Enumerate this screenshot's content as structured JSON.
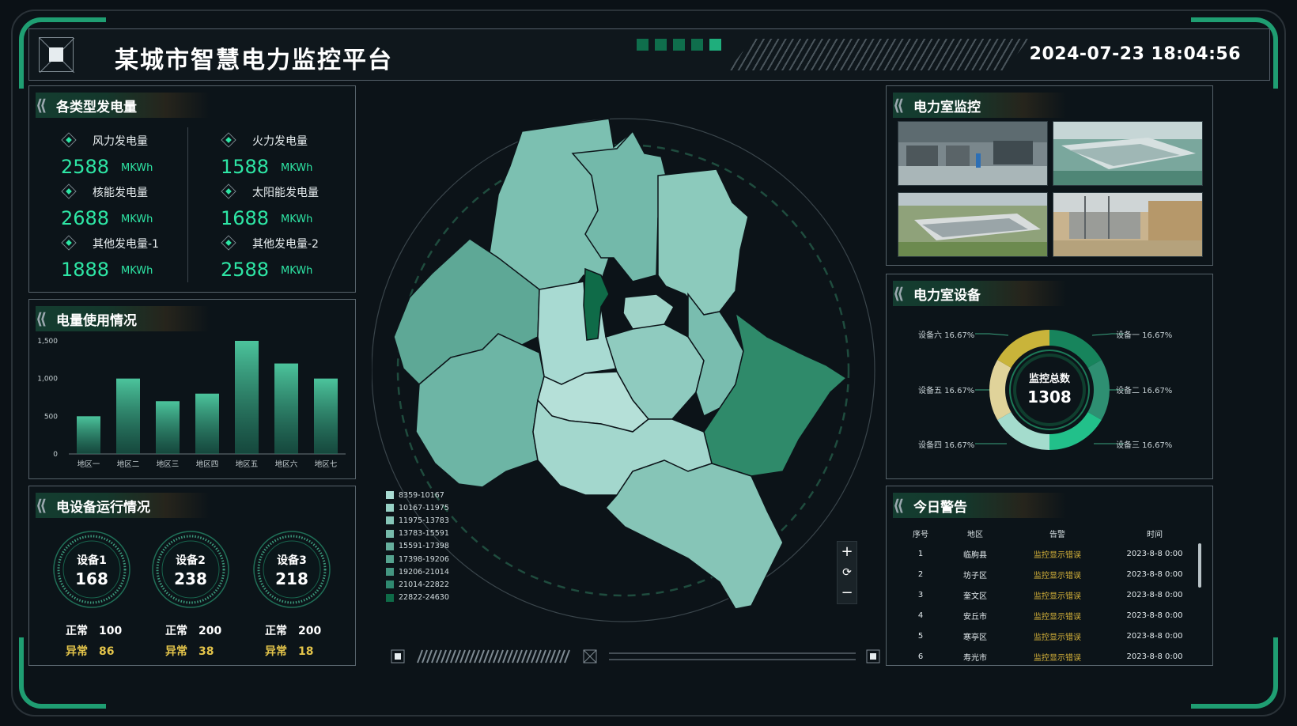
{
  "header": {
    "title": "某城市智慧电力监控平台",
    "datetime": "2024-07-23 18:04:56"
  },
  "generation": {
    "title": "各类型发电量",
    "items": [
      {
        "label": "风力发电量",
        "value": "2588",
        "unit": "MKWh"
      },
      {
        "label": "火力发电量",
        "value": "1588",
        "unit": "MKWh"
      },
      {
        "label": "核能发电量",
        "value": "2688",
        "unit": "MKWh"
      },
      {
        "label": "太阳能发电量",
        "value": "1688",
        "unit": "MKWh"
      },
      {
        "label": "其他发电量-1",
        "value": "1888",
        "unit": "MKWh"
      },
      {
        "label": "其他发电量-2",
        "value": "2588",
        "unit": "MKWh"
      }
    ]
  },
  "usage": {
    "title": "电量使用情况",
    "chart_data": {
      "type": "bar",
      "categories": [
        "地区一",
        "地区二",
        "地区三",
        "地区四",
        "地区五",
        "地区六",
        "地区七"
      ],
      "values": [
        500,
        1000,
        700,
        800,
        1500,
        1200,
        1000
      ],
      "yticks": [
        "0",
        "500",
        "1,000",
        "1,500"
      ],
      "ylim": [
        0,
        1500
      ],
      "grid": false
    }
  },
  "devices": {
    "title": "电设备运行情况",
    "items": [
      {
        "name": "设备1",
        "total": "168",
        "normal_label": "正常",
        "normal": "100",
        "abnormal_label": "异常",
        "abnormal": "86"
      },
      {
        "name": "设备2",
        "total": "238",
        "normal_label": "正常",
        "normal": "200",
        "abnormal_label": "异常",
        "abnormal": "38"
      },
      {
        "name": "设备3",
        "total": "218",
        "normal_label": "正常",
        "normal": "200",
        "abnormal_label": "异常",
        "abnormal": "18"
      }
    ]
  },
  "map": {
    "legend": [
      "8359-10167",
      "10167-11975",
      "11975-13783",
      "13783-15591",
      "15591-17398",
      "17398-19206",
      "19206-21014",
      "21014-22822",
      "22822-24630"
    ],
    "legend_colors": [
      "#a9dcd3",
      "#97d1c5",
      "#86c6b8",
      "#76bbab",
      "#66af9d",
      "#55a38f",
      "#449681",
      "#2f8970",
      "#0f6b48"
    ],
    "controls": {
      "zoom_in": "+",
      "reset": "⟳",
      "zoom_out": "−"
    }
  },
  "monitor": {
    "title": "电力室监控"
  },
  "equipment": {
    "title": "电力室设备",
    "center_label": "监控总数",
    "center_value": "1308",
    "chart_data": {
      "type": "pie",
      "categories": [
        "设备一",
        "设备二",
        "设备三",
        "设备四",
        "设备五",
        "设备六"
      ],
      "values": [
        16.67,
        16.67,
        16.67,
        16.67,
        16.67,
        16.67
      ],
      "colors": [
        "#17845c",
        "#2e8f72",
        "#22c08a",
        "#a4dccd",
        "#e0d39a",
        "#c9b43a"
      ]
    },
    "labels": [
      "设备一 16.67%",
      "设备二 16.67%",
      "设备三 16.67%",
      "设备四 16.67%",
      "设备五 16.67%",
      "设备六 16.67%"
    ]
  },
  "alerts": {
    "title": "今日警告",
    "columns": [
      "序号",
      "地区",
      "告警",
      "时间"
    ],
    "rows": [
      [
        "1",
        "临朐县",
        "监控显示错误",
        "2023-8-8 0:00"
      ],
      [
        "2",
        "坊子区",
        "监控显示错误",
        "2023-8-8 0:00"
      ],
      [
        "3",
        "奎文区",
        "监控显示错误",
        "2023-8-8 0:00"
      ],
      [
        "4",
        "安丘市",
        "监控显示错误",
        "2023-8-8 0:00"
      ],
      [
        "5",
        "寒亭区",
        "监控显示错误",
        "2023-8-8 0:00"
      ],
      [
        "6",
        "寿光市",
        "监控显示错误",
        "2023-8-8 0:00"
      ]
    ]
  },
  "colors": {
    "accent": "#2ee6a5",
    "warning": "#e2c34a",
    "brand": "#1f9e72"
  }
}
